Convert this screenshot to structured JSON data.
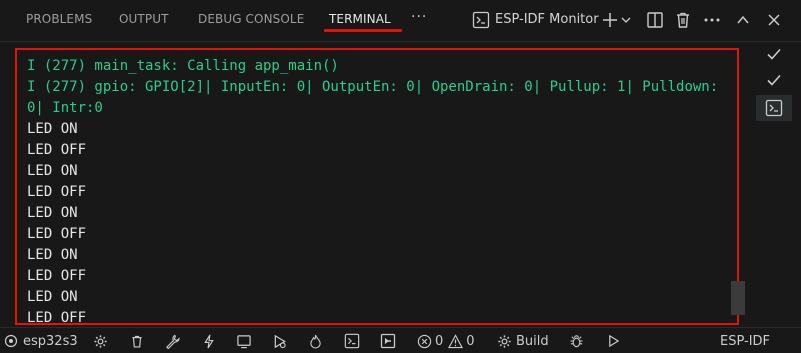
{
  "tabs": [
    {
      "label": "PROBLEMS"
    },
    {
      "label": "OUTPUT"
    },
    {
      "label": "DEBUG CONSOLE"
    },
    {
      "label": "TERMINAL",
      "active": true
    }
  ],
  "more_label": "···",
  "terminal_selector": {
    "label": "ESP-IDF Monitor"
  },
  "terminal": {
    "lines": [
      {
        "text": "I (277) main_task: Calling app_main()",
        "color": "#23d18b"
      },
      {
        "text": "I (277) gpio: GPIO[2]| InputEn: 0| OutputEn: 0| OpenDrain: 0| Pullup: 1| Pulldown: 0| Intr:0",
        "color": "#23d18b"
      },
      {
        "text": "LED ON"
      },
      {
        "text": "LED OFF"
      },
      {
        "text": "LED ON"
      },
      {
        "text": "LED OFF"
      },
      {
        "text": "LED ON"
      },
      {
        "text": "LED OFF"
      },
      {
        "text": "LED ON"
      },
      {
        "text": "LED OFF"
      },
      {
        "text": "LED ON"
      },
      {
        "text": "LED OFF"
      }
    ]
  },
  "side_list": [
    {
      "icon": "check-icon"
    },
    {
      "icon": "check-icon"
    },
    {
      "icon": "terminal-icon",
      "active": true
    }
  ],
  "statusbar": {
    "chip_label": "esp32s3",
    "errors": "0",
    "warnings": "0",
    "build_label": "Build",
    "right_label": "ESP-IDF"
  },
  "colors": {
    "highlight_border": "#e51400",
    "terminal_green": "#23d18b",
    "background": "#181818"
  }
}
